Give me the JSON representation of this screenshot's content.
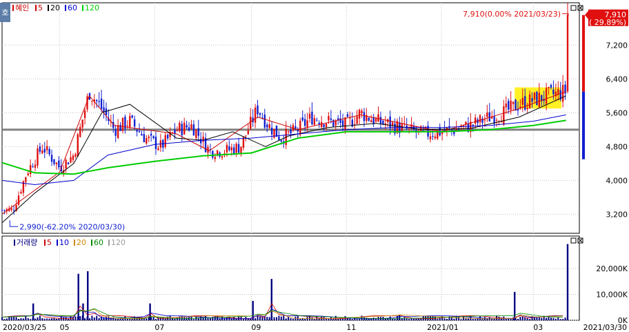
{
  "price_panel": {
    "legend": [
      {
        "label": "혜인",
        "color": "#cc0000"
      },
      {
        "label": "5",
        "color": "#cc0000"
      },
      {
        "label": "20",
        "color": "#000000"
      },
      {
        "label": "60",
        "color": "#0000cc"
      },
      {
        "label": "120",
        "color": "#00cc00"
      }
    ],
    "side_tab": "호",
    "high_annotation": "7,910(0.00% 2021/03/23)",
    "low_annotation": "2,990(-62.20% 2020/03/30)",
    "current_price_box": {
      "price": "7,910",
      "change": "( 29.89%)"
    }
  },
  "volume_panel": {
    "legend": [
      {
        "label": "거래량",
        "color": "#000080"
      },
      {
        "label": "5",
        "color": "#cc0000"
      },
      {
        "label": "10",
        "color": "#0000cc"
      },
      {
        "label": "20",
        "color": "#cc8800"
      },
      {
        "label": "60",
        "color": "#008800"
      },
      {
        "label": "120",
        "color": "#999999"
      }
    ]
  },
  "colors": {
    "up": "#e01010",
    "down": "#1020d0",
    "ma5": "#cc0000",
    "ma20": "#000000",
    "ma60": "#0000cc",
    "ma120": "#00cc00",
    "reference": "#808080",
    "grid": "#c0c0c0",
    "highlight": "#ffee00"
  },
  "chart_data": [
    {
      "type": "line",
      "title": "혜인",
      "subtype": "candlestick",
      "x_range": [
        "2020/03/25",
        "2021/03/30"
      ],
      "x_tick_labels": [
        "2020/03/25",
        "05",
        "07",
        "09",
        "11",
        "2021/01",
        "03",
        "2021/03/30"
      ],
      "y_ticks": [
        3200,
        4000,
        4800,
        5600,
        6400,
        7200
      ],
      "y_tick_labels": [
        "3,200",
        "4,000",
        "4,800",
        "5,600",
        "6,400",
        "7,200"
      ],
      "ylim": [
        2750,
        8200
      ],
      "grid": true,
      "reference_line": 5200,
      "highlight_zone": {
        "x_start": "2021/02/17",
        "x_end": "2021/03/19",
        "y_low": 5700,
        "y_high": 6200
      },
      "close_series": {
        "x": [
          "2020/03/25",
          "2020/04/01",
          "2020/04/10",
          "2020/04/20",
          "2020/05/01",
          "2020/05/10",
          "2020/05/20",
          "2020/05/28",
          "2020/06/05",
          "2020/06/15",
          "2020/06/25",
          "2020/07/05",
          "2020/07/15",
          "2020/07/25",
          "2020/08/05",
          "2020/08/15",
          "2020/08/25",
          "2020/09/05",
          "2020/09/12",
          "2020/09/20",
          "2020/10/01",
          "2020/10/10",
          "2020/10/20",
          "2020/11/01",
          "2020/11/10",
          "2020/11/20",
          "2020/12/01",
          "2020/12/10",
          "2020/12/20",
          "2021/01/01",
          "2021/01/10",
          "2021/01/20",
          "2021/02/01",
          "2021/02/10",
          "2021/02/20",
          "2021/03/01",
          "2021/03/10",
          "2021/03/22",
          "2021/03/23"
        ],
        "values": [
          3300,
          3300,
          4200,
          4800,
          4300,
          4600,
          6100,
          5700,
          5200,
          5400,
          5000,
          4800,
          5200,
          5300,
          4700,
          4700,
          4800,
          5700,
          5300,
          5000,
          5200,
          5500,
          5400,
          5300,
          5600,
          5400,
          5300,
          5200,
          5100,
          5150,
          5200,
          5300,
          5500,
          5600,
          5800,
          5900,
          6000,
          6100,
          7910
        ]
      },
      "high": {
        "value": 7910,
        "date": "2021/03/23"
      },
      "low": {
        "value": 2990,
        "date": "2020/03/30"
      },
      "series": [
        {
          "name": "5",
          "x": [
            "2020/03/25",
            "2020/05/01",
            "2020/05/20",
            "2020/06/05",
            "2020/07/15",
            "2020/08/05",
            "2020/09/05",
            "2020/10/01",
            "2020/11/10",
            "2021/01/01",
            "2021/02/20",
            "2021/03/22"
          ],
          "values": [
            3200,
            4200,
            6000,
            5300,
            5100,
            4700,
            5500,
            5200,
            5550,
            5150,
            5700,
            6100
          ]
        },
        {
          "name": "20",
          "x": [
            "2020/03/25",
            "2020/04/15",
            "2020/05/10",
            "2020/05/28",
            "2020/06/15",
            "2020/07/15",
            "2020/08/01",
            "2020/08/20",
            "2020/09/10",
            "2020/09/25",
            "2020/10/20",
            "2020/11/20",
            "2020/12/20",
            "2021/01/20",
            "2021/02/20",
            "2021/03/22"
          ],
          "values": [
            3000,
            3700,
            4400,
            5600,
            5800,
            5000,
            4950,
            5150,
            4800,
            5050,
            5250,
            5350,
            5200,
            5230,
            5500,
            6000
          ]
        },
        {
          "name": "60",
          "x": [
            "2020/03/25",
            "2020/04/15",
            "2020/05/10",
            "2020/06/01",
            "2020/07/01",
            "2020/08/01",
            "2020/09/01",
            "2020/10/01",
            "2020/11/01",
            "2020/12/01",
            "2021/01/01",
            "2021/02/01",
            "2021/03/01",
            "2021/03/22"
          ],
          "values": [
            4000,
            3900,
            4000,
            4600,
            4850,
            4950,
            5000,
            5100,
            5200,
            5250,
            5250,
            5300,
            5400,
            5550
          ]
        },
        {
          "name": "120",
          "x": [
            "2020/03/25",
            "2020/04/15",
            "2020/05/10",
            "2020/06/01",
            "2020/07/01",
            "2020/08/01",
            "2020/09/01",
            "2020/10/01",
            "2020/11/01",
            "2020/12/01",
            "2021/01/01",
            "2021/02/01",
            "2021/03/01",
            "2021/03/22"
          ],
          "values": [
            4420,
            4180,
            4150,
            4300,
            4450,
            4580,
            4650,
            5000,
            5150,
            5150,
            5150,
            5200,
            5300,
            5420
          ]
        }
      ]
    },
    {
      "type": "bar",
      "title": "거래량",
      "x_range": [
        "2020/03/25",
        "2021/03/30"
      ],
      "y_ticks": [
        0,
        10000,
        20000
      ],
      "y_tick_labels": [
        "0K",
        "10,000K",
        "20,000K"
      ],
      "ylim": [
        0,
        31000
      ],
      "unit": "K",
      "spikes": {
        "x": [
          "2020/04/14",
          "2020/05/13",
          "2020/05/16",
          "2020/05/19",
          "2020/06/28",
          "2020/09/02",
          "2020/09/14",
          "2020/12/05",
          "2021/02/17",
          "2021/03/23"
        ],
        "values": [
          6500,
          18000,
          6500,
          19000,
          6500,
          7500,
          16000,
          2000,
          11000,
          29500
        ]
      },
      "baseline_volume": 1500
    }
  ]
}
